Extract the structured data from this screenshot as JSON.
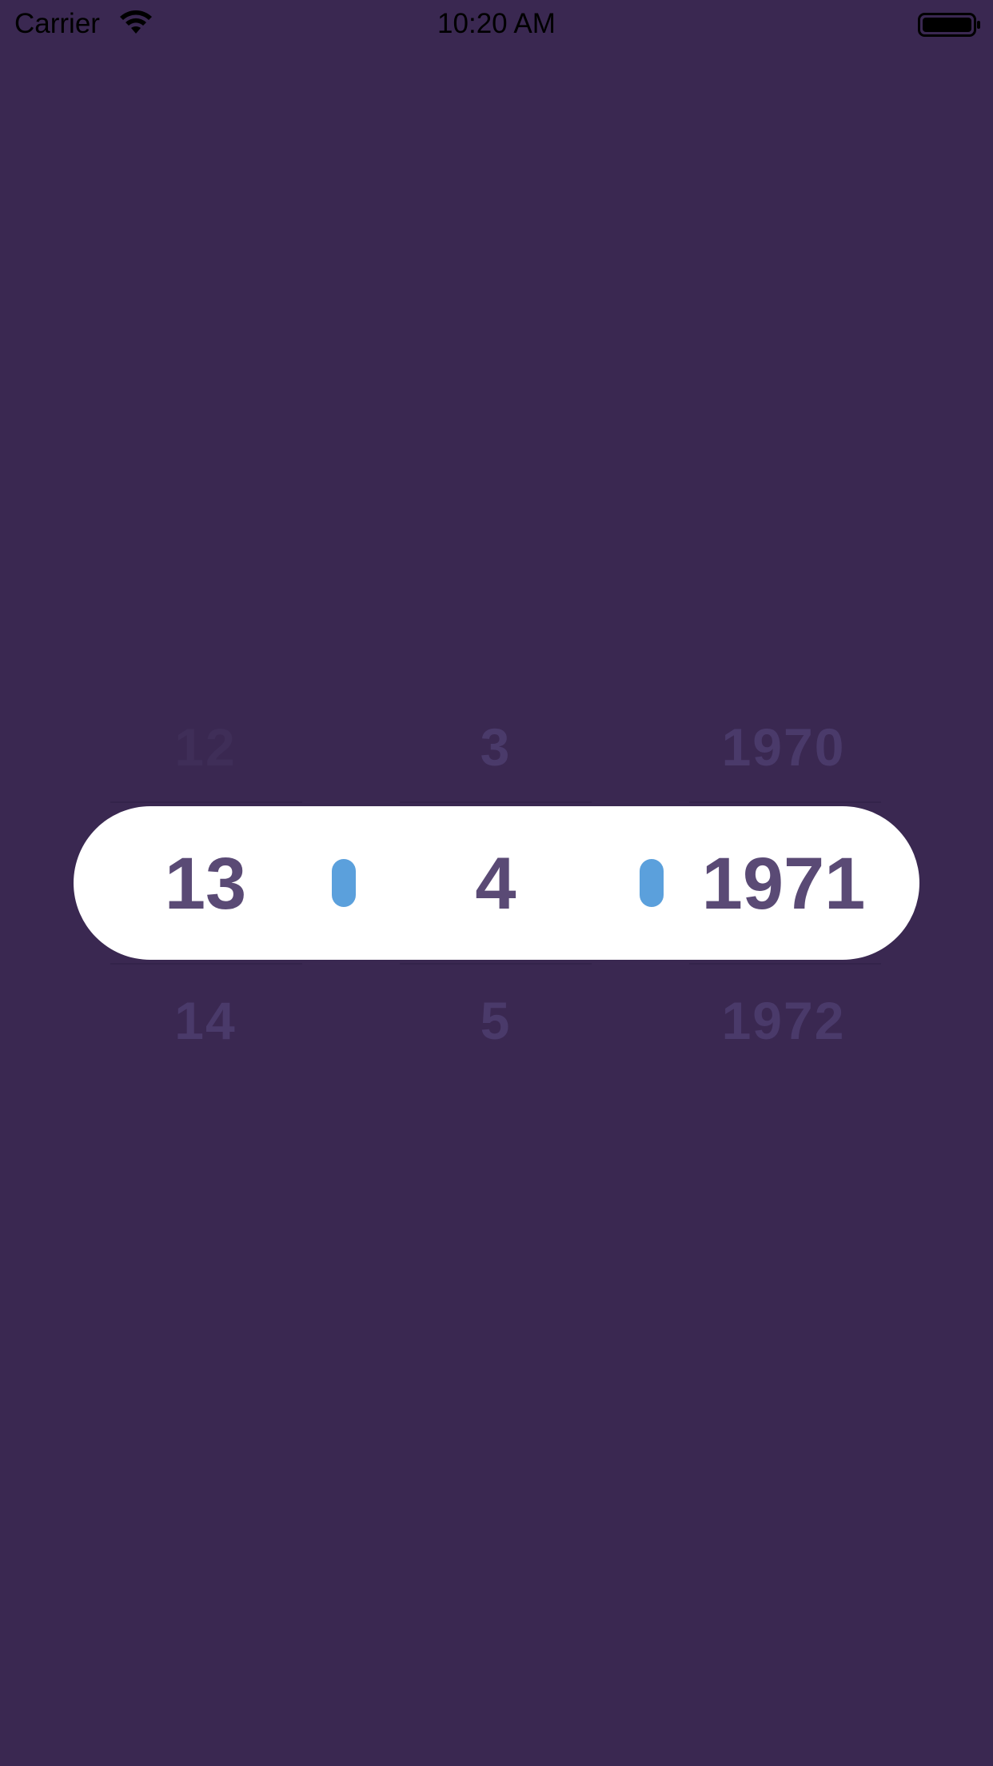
{
  "status_bar": {
    "carrier": "Carrier",
    "time": "10:20 AM",
    "wifi_icon": "wifi-icon",
    "battery_icon": "battery-icon"
  },
  "picker": {
    "day": {
      "previous": "12",
      "selected": "13",
      "next": "14"
    },
    "month": {
      "previous": "3",
      "selected": "4",
      "next": "5"
    },
    "year": {
      "previous": "1970",
      "selected": "1971",
      "next": "1972"
    },
    "separator_color": "#5ba0dc",
    "selected_text_color": "#5a4a75",
    "background_color": "#3a2851"
  }
}
